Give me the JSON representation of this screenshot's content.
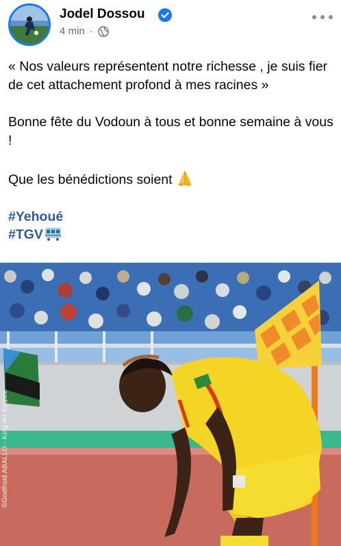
{
  "post": {
    "author": "Jodel Dossou",
    "time": "4 min",
    "separator": "·",
    "paragraphs": [
      "« Nos valeurs représentent notre richesse , je suis fier de cet attachement profond à mes racines »",
      "Bonne fête du Vodoun à tous et bonne semaine à vous !",
      "Que les bénédictions soient"
    ],
    "hashtags": [
      "#Yehoué",
      "#TGV"
    ]
  },
  "photo": {
    "watermark": "©Godfroid ABALLO - King Art Empire"
  },
  "icons": {
    "verified": "verified-badge-icon",
    "privacy": "globe-icon",
    "more": "more-options-icon",
    "pray": "folded-hands-emoji",
    "train": "train-emoji"
  },
  "colors": {
    "accent": "#1877f2",
    "hashtag": "#2d5b95",
    "meta": "#65676b",
    "jersey": "#f5d62a"
  }
}
